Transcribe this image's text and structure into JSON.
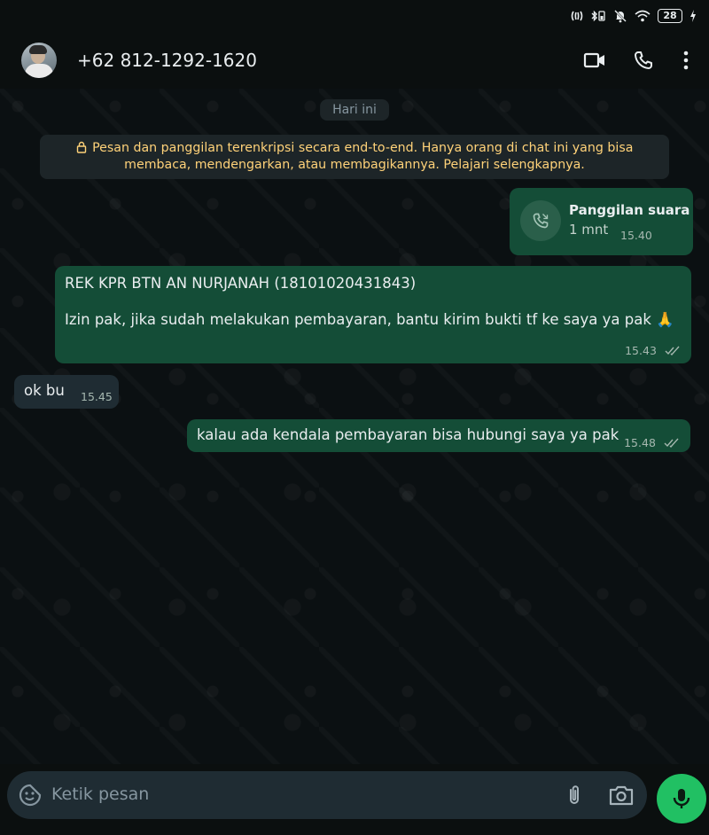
{
  "status_bar": {
    "battery": "28"
  },
  "header": {
    "contact_name": "+62 812-1292-1620"
  },
  "chat": {
    "date_chip": "Hari ini",
    "encryption_notice": "Pesan dan panggilan terenkripsi secara end-to-end. Hanya orang di chat ini yang bisa membaca, mendengarkan, atau membagikannya. Pelajari selengkapnya.",
    "messages": [
      {
        "type": "call",
        "title": "Panggilan suara",
        "duration": "1 mnt",
        "time": "15.40"
      },
      {
        "type": "outgoing",
        "line1": "REK KPR BTN AN NURJANAH (18101020431843)",
        "line2": "Izin pak, jika sudah melakukan pembayaran, bantu kirim bukti tf ke saya ya pak 🙏",
        "time": "15.43"
      },
      {
        "type": "incoming",
        "text": "ok bu",
        "time": "15.45"
      },
      {
        "type": "outgoing",
        "text": "kalau ada kendala pembayaran bisa hubungi saya ya pak",
        "time": "15.48"
      }
    ]
  },
  "composer": {
    "placeholder": "Ketik pesan"
  },
  "colors": {
    "outgoing_bubble": "#144d37",
    "incoming_bubble": "#1f2c33",
    "mic_button": "#21c063",
    "notice_text": "#ffd279"
  }
}
